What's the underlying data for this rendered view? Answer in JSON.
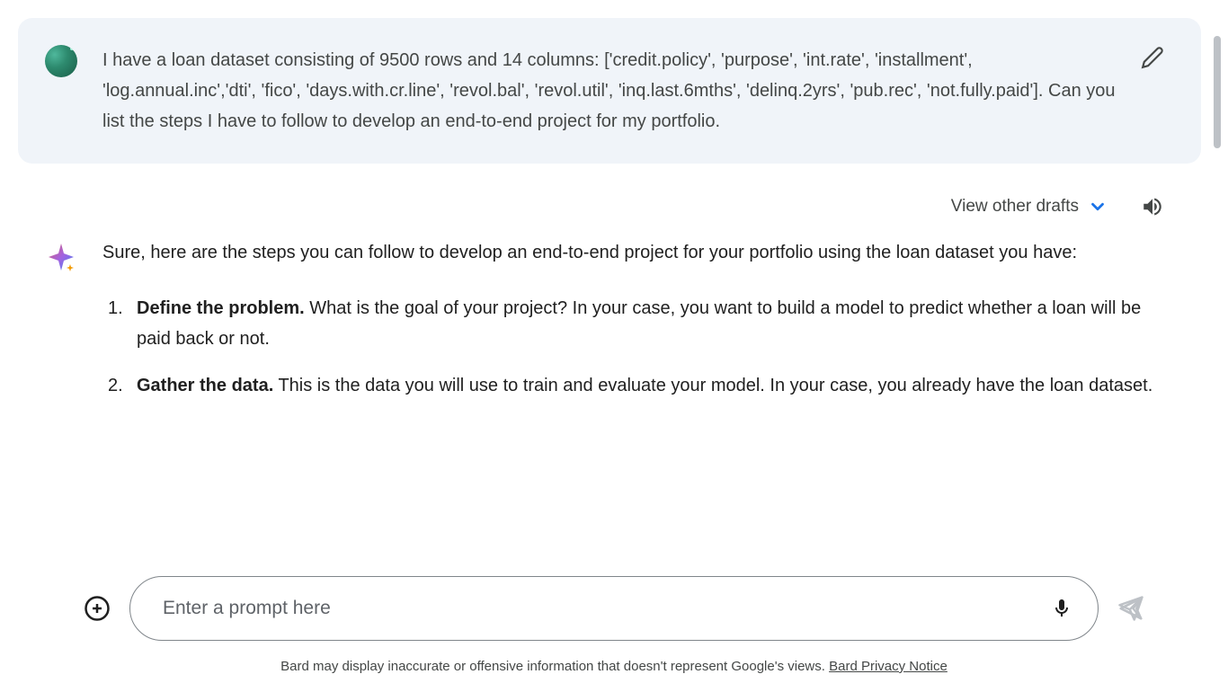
{
  "user_message": {
    "text": "I have a loan dataset consisting of 9500 rows and 14 columns: ['credit.policy', 'purpose', 'int.rate', 'installment', 'log.annual.inc','dti', 'fico', 'days.with.cr.line', 'revol.bal', 'revol.util', 'inq.last.6mths', 'delinq.2yrs', 'pub.rec', 'not.fully.paid']. Can you list the steps I have to follow to develop an end-to-end project for my portfolio."
  },
  "bot_header": {
    "drafts_label": "View other drafts"
  },
  "bot_response": {
    "intro": "Sure, here are the steps you can follow to develop an end-to-end project for your portfolio using the loan dataset you have:",
    "steps": [
      {
        "number": "1.",
        "title": "Define the problem.",
        "body": " What is the goal of your project? In your case, you want to build a model to predict whether a loan will be paid back or not."
      },
      {
        "number": "2.",
        "title": "Gather the data.",
        "body": " This is the data you will use to train and evaluate your model. In your case, you already have the loan dataset."
      }
    ]
  },
  "input": {
    "placeholder": "Enter a prompt here"
  },
  "disclaimer": {
    "text": "Bard may display inaccurate or offensive information that doesn't represent Google's views. ",
    "link_text": "Bard Privacy Notice"
  }
}
